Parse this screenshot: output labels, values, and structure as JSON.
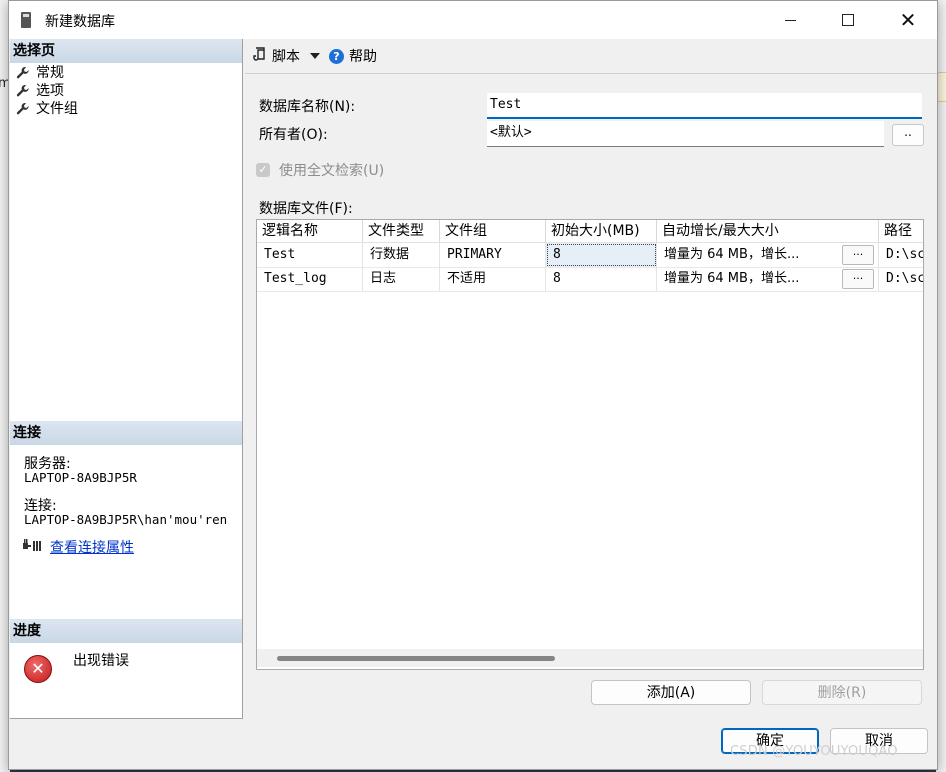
{
  "window": {
    "title": "新建数据库"
  },
  "left_pane": {
    "select_page_header": "选择页",
    "pages": [
      {
        "label": "常规"
      },
      {
        "label": "选项"
      },
      {
        "label": "文件组"
      }
    ],
    "connection_header": "连接",
    "server_label": "服务器:",
    "server_value": "LAPTOP-8A9BJP5R",
    "connection_label": "连接:",
    "connection_value": "LAPTOP-8A9BJP5R\\han'mou'ren",
    "view_connection_props": "查看连接属性",
    "progress_header": "进度",
    "progress_text": "出现错误"
  },
  "toolbar": {
    "script_label": "脚本",
    "help_label": "帮助"
  },
  "form": {
    "db_name_label": "数据库名称(N):",
    "db_name_value": "Test",
    "owner_label": "所有者(O):",
    "owner_value": "<默认>",
    "owner_browse": "..",
    "fulltext_label": "使用全文检索(U)",
    "fulltext_checked": true,
    "files_label": "数据库文件(F):"
  },
  "grid": {
    "columns": [
      "逻辑名称",
      "文件类型",
      "文件组",
      "初始大小(MB)",
      "自动增长/最大大小",
      "路径"
    ],
    "rows": [
      {
        "logical_name": "Test",
        "file_type": "行数据",
        "filegroup": "PRIMARY",
        "initial_size": "8",
        "autogrowth": "增量为 64 MB，增长...",
        "autogrowth_button": "...",
        "path": "D:\\sc"
      },
      {
        "logical_name": "Test_log",
        "file_type": "日志",
        "filegroup": "不适用",
        "initial_size": "8",
        "autogrowth": "增量为 64 MB，增长...",
        "autogrowth_button": "...",
        "path": "D:\\sc"
      }
    ]
  },
  "buttons": {
    "add": "添加(A)",
    "remove": "删除(R)",
    "ok": "确定",
    "cancel": "取消"
  },
  "watermark": "CSDN @YOUYOUYOUQAO"
}
